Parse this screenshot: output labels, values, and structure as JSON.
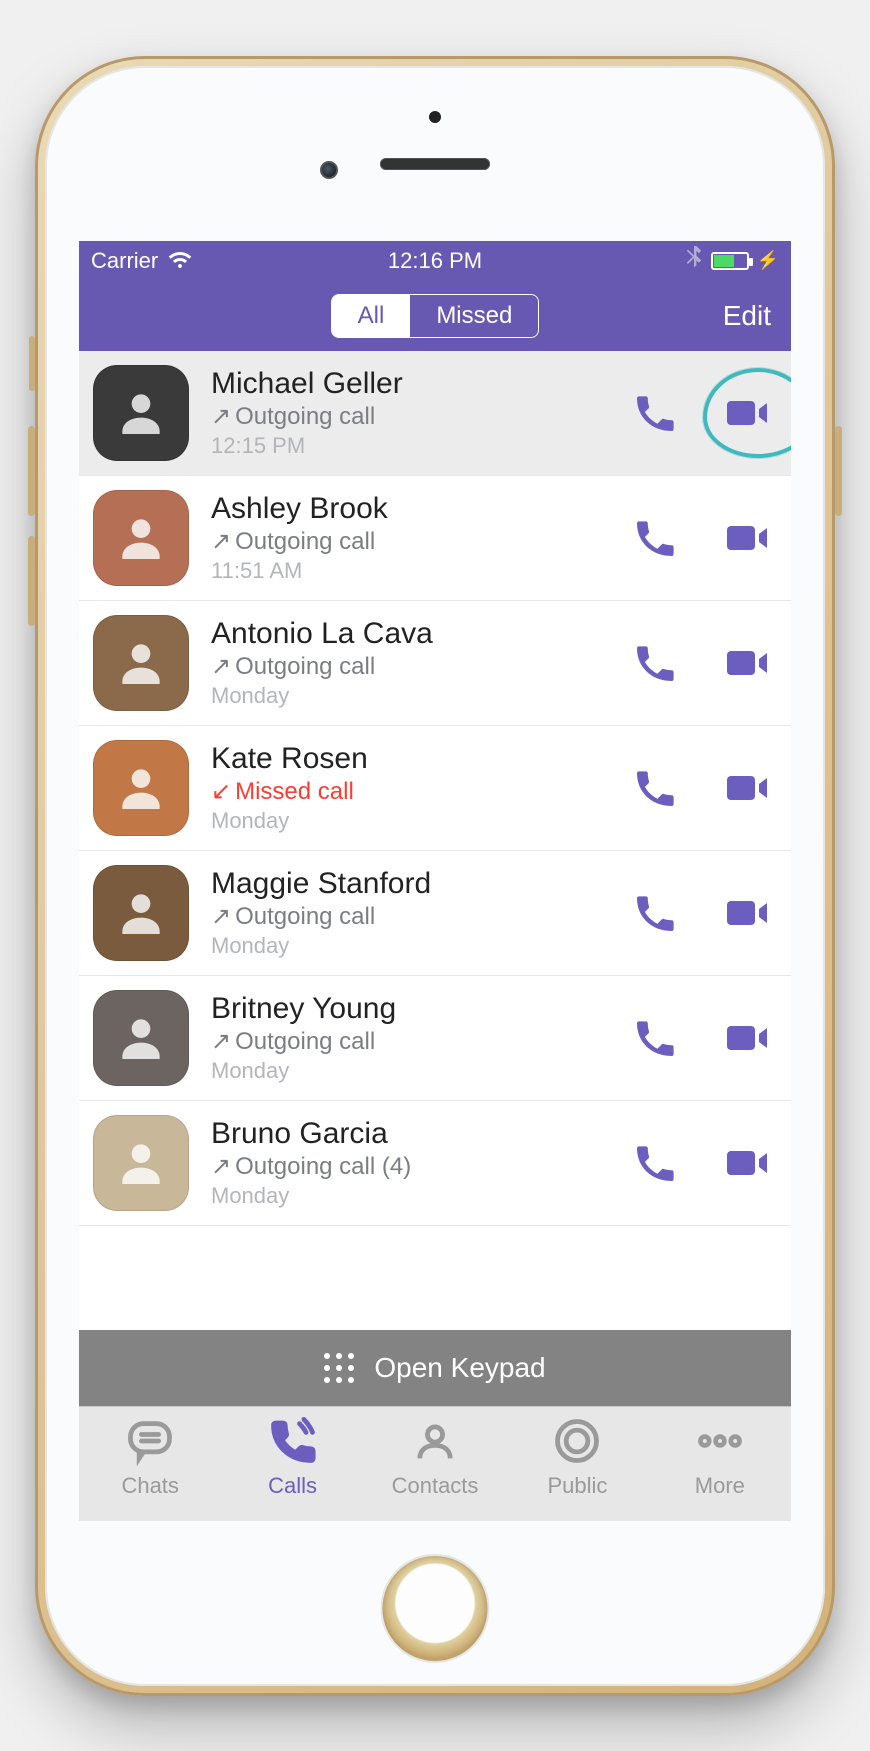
{
  "statusbar": {
    "carrier": "Carrier",
    "time": "12:16 PM"
  },
  "navbar": {
    "seg_all": "All",
    "seg_missed": "Missed",
    "edit": "Edit"
  },
  "calls": [
    {
      "name": "Michael Geller",
      "type": "Outgoing call",
      "time": "12:15  PM",
      "missed": false,
      "selected": true,
      "avatar": "#3a3a3a",
      "highlight_video": true
    },
    {
      "name": "Ashley Brook",
      "type": "Outgoing call",
      "time": "11:51  AM",
      "missed": false,
      "selected": false,
      "avatar": "#b56f55"
    },
    {
      "name": "Antonio La Cava",
      "type": "Outgoing call",
      "time": "Monday",
      "missed": false,
      "selected": false,
      "avatar": "#8a6a4a"
    },
    {
      "name": "Kate Rosen",
      "type": "Missed call",
      "time": "Monday",
      "missed": true,
      "selected": false,
      "avatar": "#c27846"
    },
    {
      "name": "Maggie Stanford",
      "type": "Outgoing call",
      "time": "Monday",
      "missed": false,
      "selected": false,
      "avatar": "#7b5b3d"
    },
    {
      "name": "Britney Young",
      "type": "Outgoing call",
      "time": "Monday",
      "missed": false,
      "selected": false,
      "avatar": "#6b6460"
    },
    {
      "name": "Bruno Garcia",
      "type": "Outgoing call (4)",
      "time": "Monday",
      "missed": false,
      "selected": false,
      "avatar": "#c9b79a"
    }
  ],
  "keypad": {
    "label": "Open Keypad"
  },
  "tabs": [
    {
      "id": "chats",
      "label": "Chats",
      "active": false
    },
    {
      "id": "calls",
      "label": "Calls",
      "active": true
    },
    {
      "id": "contacts",
      "label": "Contacts",
      "active": false
    },
    {
      "id": "public",
      "label": "Public",
      "active": false
    },
    {
      "id": "more",
      "label": "More",
      "active": false
    }
  ]
}
